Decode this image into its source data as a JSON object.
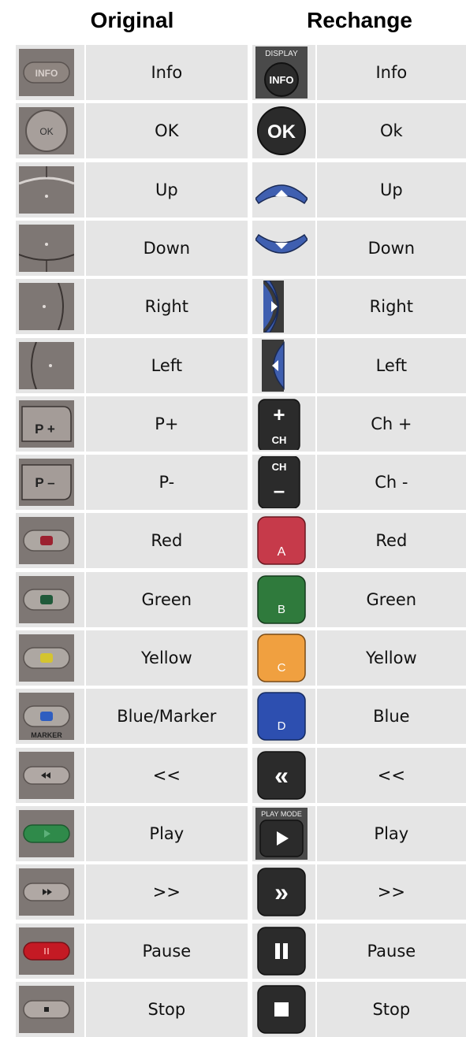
{
  "headers": {
    "original": "Original",
    "rechange": "Rechange"
  },
  "rows": [
    {
      "original_label": "Info",
      "new_label": "Info",
      "original_icon": "info-button-icon",
      "new_icon": "display-info-button-icon",
      "new_icon_text": [
        "DISPLAY",
        "INFO"
      ],
      "original_icon_text": "INFO"
    },
    {
      "original_label": "OK",
      "new_label": "Ok",
      "original_icon": "ok-button-icon",
      "new_icon": "ok-button-icon",
      "original_icon_text": "OK",
      "new_icon_text": "OK"
    },
    {
      "original_label": "Up",
      "new_label": "Up",
      "original_icon": "up-arrow-pad-icon",
      "new_icon": "up-arrow-blue-icon"
    },
    {
      "original_label": "Down",
      "new_label": "Down",
      "original_icon": "down-arrow-pad-icon",
      "new_icon": "down-arrow-blue-icon"
    },
    {
      "original_label": "Right",
      "new_label": "Right",
      "original_icon": "right-arrow-pad-icon",
      "new_icon": "right-arrow-blue-icon"
    },
    {
      "original_label": "Left",
      "new_label": "Left",
      "original_icon": "left-arrow-pad-icon",
      "new_icon": "left-arrow-blue-icon"
    },
    {
      "original_label": "P+",
      "new_label": "Ch +",
      "original_icon": "p-plus-button-icon",
      "new_icon": "ch-plus-button-icon",
      "original_icon_text": "P +",
      "new_icon_text": [
        "+",
        "CH"
      ]
    },
    {
      "original_label": "P-",
      "new_label": "Ch -",
      "original_icon": "p-minus-button-icon",
      "new_icon": "ch-minus-button-icon",
      "original_icon_text": "P –",
      "new_icon_text": [
        "CH",
        "–"
      ]
    },
    {
      "original_label": "Red",
      "new_label": "Red",
      "original_icon": "red-button-icon",
      "new_icon": "a-red-button-icon",
      "new_icon_text": "A"
    },
    {
      "original_label": "Green",
      "new_label": "Green",
      "original_icon": "green-button-icon",
      "new_icon": "b-green-button-icon",
      "new_icon_text": "B"
    },
    {
      "original_label": "Yellow",
      "new_label": "Yellow",
      "original_icon": "yellow-button-icon",
      "new_icon": "c-yellow-button-icon",
      "new_icon_text": "C"
    },
    {
      "original_label": "Blue/Marker",
      "new_label": "Blue",
      "original_icon": "blue-marker-button-icon",
      "new_icon": "d-blue-button-icon",
      "original_icon_text": "MARKER",
      "new_icon_text": "D"
    },
    {
      "original_label": "<<",
      "new_label": "<<",
      "original_icon": "rewind-button-icon",
      "new_icon": "rewind-button-icon"
    },
    {
      "original_label": "Play",
      "new_label": "Play",
      "original_icon": "play-button-icon",
      "new_icon": "play-mode-button-icon",
      "new_icon_text": "PLAY MODE"
    },
    {
      "original_label": ">>",
      "new_label": ">>",
      "original_icon": "fast-forward-button-icon",
      "new_icon": "fast-forward-button-icon"
    },
    {
      "original_label": "Pause",
      "new_label": "Pause",
      "original_icon": "pause-button-icon",
      "new_icon": "pause-button-icon"
    },
    {
      "original_label": "Stop",
      "new_label": "Stop",
      "original_icon": "stop-button-icon",
      "new_icon": "stop-button-icon"
    }
  ],
  "colors": {
    "cell_bg": "#e5e5e5",
    "old_remote_grey": "#8a8380",
    "new_remote_dark": "#2b2b2b",
    "nav_blue": "#3f5fb0",
    "red": "#c63a4a",
    "green": "#2f7a3c",
    "yellow": "#f0a040",
    "blue": "#2d4fb0"
  }
}
